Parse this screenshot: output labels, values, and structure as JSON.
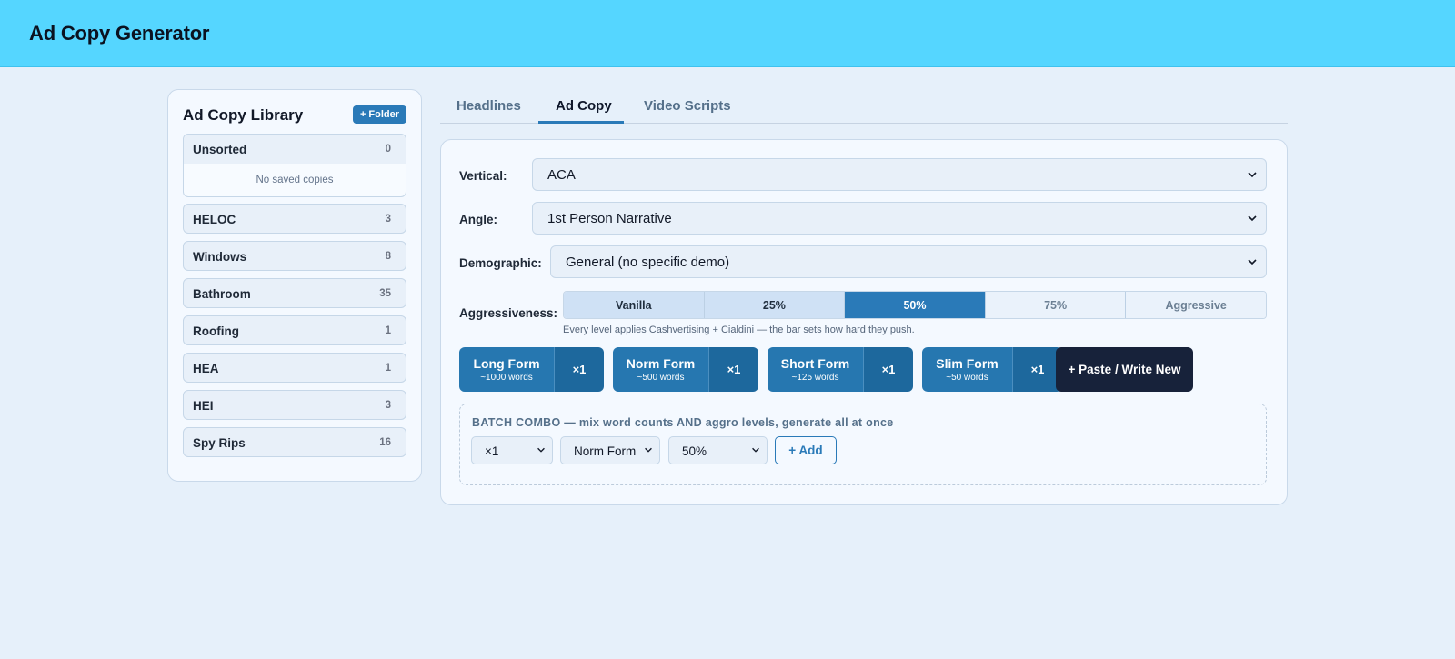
{
  "app": {
    "title": "Ad Copy Generator"
  },
  "library": {
    "title": "Ad Copy Library",
    "add_folder_label": "+ Folder",
    "folders": [
      {
        "name": "Unsorted",
        "count": "0",
        "empty_text": "No saved copies"
      },
      {
        "name": "HELOC",
        "count": "3"
      },
      {
        "name": "Windows",
        "count": "8"
      },
      {
        "name": "Bathroom",
        "count": "35"
      },
      {
        "name": "Roofing",
        "count": "1"
      },
      {
        "name": "HEA",
        "count": "1"
      },
      {
        "name": "HEI",
        "count": "3"
      },
      {
        "name": "Spy Rips",
        "count": "16"
      }
    ]
  },
  "tabs": [
    {
      "label": "Headlines"
    },
    {
      "label": "Ad Copy",
      "active": true
    },
    {
      "label": "Video Scripts"
    }
  ],
  "form": {
    "vertical": {
      "label": "Vertical:",
      "value": "ACA"
    },
    "angle": {
      "label": "Angle:",
      "value": "1st Person Narrative"
    },
    "demographic": {
      "label": "Demographic:",
      "value": "General (no specific demo)"
    },
    "aggressiveness": {
      "label": "Aggressiveness:",
      "levels": [
        "Vanilla",
        "25%",
        "50%",
        "75%",
        "Aggressive"
      ],
      "selected": "50%",
      "hint": "Every level applies Cashvertising + Cialdini — the bar sets how hard they push."
    }
  },
  "lengths": [
    {
      "name": "Long Form",
      "words": "~1000 words",
      "multiplier": "×1"
    },
    {
      "name": "Norm Form",
      "words": "~500 words",
      "multiplier": "×1"
    },
    {
      "name": "Short Form",
      "words": "~125 words",
      "multiplier": "×1"
    },
    {
      "name": "Slim Form",
      "words": "~50 words",
      "multiplier": "×1"
    }
  ],
  "paste_label": "+ Paste / Write New",
  "batch": {
    "title": "BATCH COMBO — mix word counts AND aggro levels, generate all at once",
    "count": "×1",
    "form": "Norm Form",
    "aggro": "50%",
    "add_label": "+ Add"
  },
  "colors": {
    "header": "#55d6ff",
    "accent": "#2a7ab8",
    "dark_button": "#17223a"
  }
}
